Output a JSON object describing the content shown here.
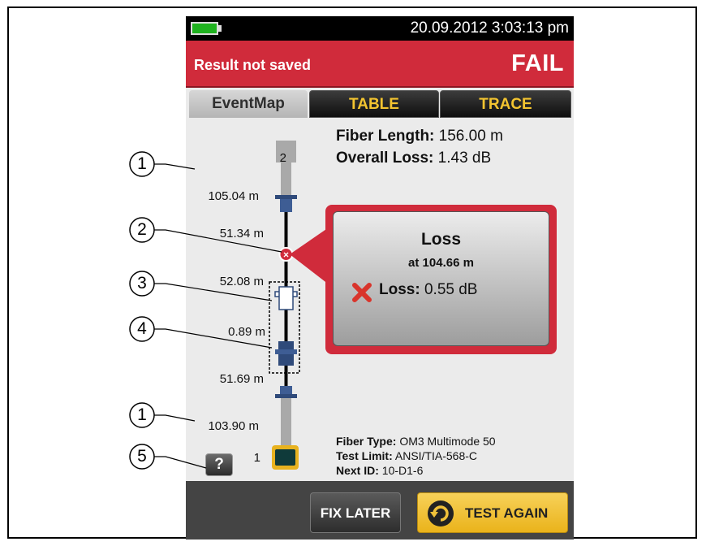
{
  "status_bar": {
    "datetime": "20.09.2012 3:03:13 pm"
  },
  "header": {
    "save_status": "Result not saved",
    "result": "FAIL"
  },
  "tabs": [
    {
      "label": "EventMap",
      "active": true
    },
    {
      "label": "TABLE",
      "active": false
    },
    {
      "label": "TRACE",
      "active": false
    }
  ],
  "summary": {
    "fiber_length_label": "Fiber Length:",
    "fiber_length_value": "156.00 m",
    "overall_loss_label": "Overall Loss:",
    "overall_loss_value": "1.43 dB"
  },
  "event_map": {
    "end_label_top": "2",
    "end_label_bottom": "1",
    "distances": [
      "105.04 m",
      "51.34 m",
      "52.08 m",
      "0.89 m",
      "51.69 m",
      "103.90 m"
    ]
  },
  "popup": {
    "title": "Loss",
    "subtitle": "at 104.66 m",
    "loss_label": "Loss:",
    "loss_value": "0.55 dB"
  },
  "details": {
    "fiber_type_label": "Fiber Type:",
    "fiber_type_value": "OM3 Multimode 50",
    "test_limit_label": "Test Limit:",
    "test_limit_value": "ANSI/TIA-568-C",
    "next_id_label": "Next ID:",
    "next_id_value": "10-D1-6"
  },
  "help_button": {
    "label": "?"
  },
  "buttons": {
    "fix_later": "FIX LATER",
    "test_again": "TEST AGAIN"
  },
  "callouts": [
    "1",
    "2",
    "3",
    "4",
    "1",
    "5"
  ],
  "colors": {
    "fail_red": "#d02b3b",
    "tab_gold": "#f3c430",
    "test_again_yellow": "#eab31b",
    "battery_green": "#1fb21f"
  }
}
